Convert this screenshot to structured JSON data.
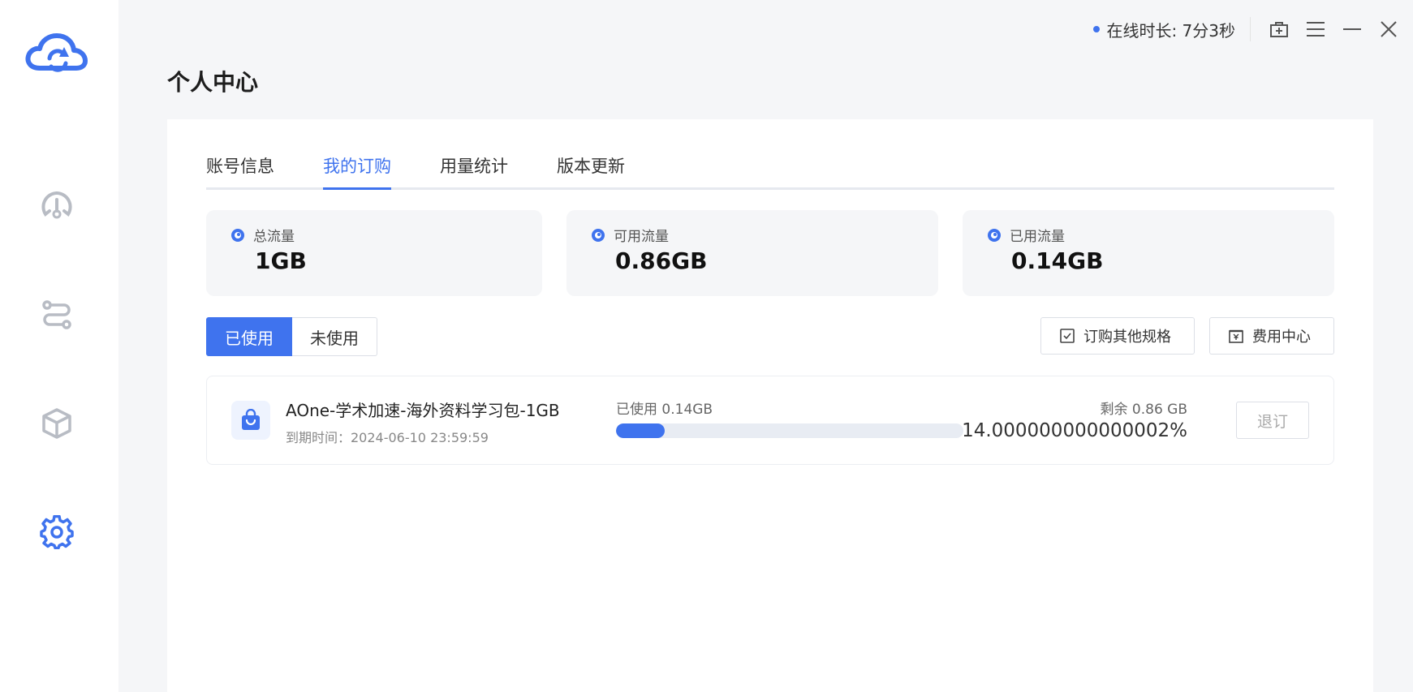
{
  "colors": {
    "accent": "#3f73ee",
    "sidebar_bg": "#ffffff",
    "page_bg": "#f5f6f8",
    "icon_inactive": "#b8bcc4"
  },
  "sidebar": {
    "logo_icon": "cloud-sync-logo-icon",
    "items": [
      {
        "icon": "speedometer-icon",
        "active": false
      },
      {
        "icon": "route-icon",
        "active": false
      },
      {
        "icon": "cube-icon",
        "active": false
      },
      {
        "icon": "gear-icon",
        "active": true
      }
    ]
  },
  "topbar": {
    "online_label": "在线时长: 7分3秒",
    "buttons": [
      "gift-icon",
      "menu-icon",
      "minimize-icon",
      "close-icon"
    ]
  },
  "page": {
    "title": "个人中心"
  },
  "tabs": [
    {
      "label": "账号信息",
      "active": false
    },
    {
      "label": "我的订购",
      "active": true
    },
    {
      "label": "用量统计",
      "active": false
    },
    {
      "label": "版本更新",
      "active": false
    }
  ],
  "stats": [
    {
      "label": "总流量",
      "value": "1GB"
    },
    {
      "label": "可用流量",
      "value": "0.86GB"
    },
    {
      "label": "已用流量",
      "value": "0.14GB"
    }
  ],
  "filter": {
    "used_label": "已使用",
    "unused_label": "未使用",
    "selected": "已使用"
  },
  "actions": {
    "order_other_label": "订购其他规格",
    "billing_center_label": "费用中心"
  },
  "order": {
    "name": "AOne-学术加速-海外资料学习包-1GB",
    "expire": "到期时间：2024-06-10 23:59:59",
    "used_text": "已使用 0.14GB",
    "remain_text": "剩余 0.86 GB",
    "percent_text": "14.000000000000002%",
    "progress_percent": 14,
    "unsubscribe_label": "退订"
  }
}
